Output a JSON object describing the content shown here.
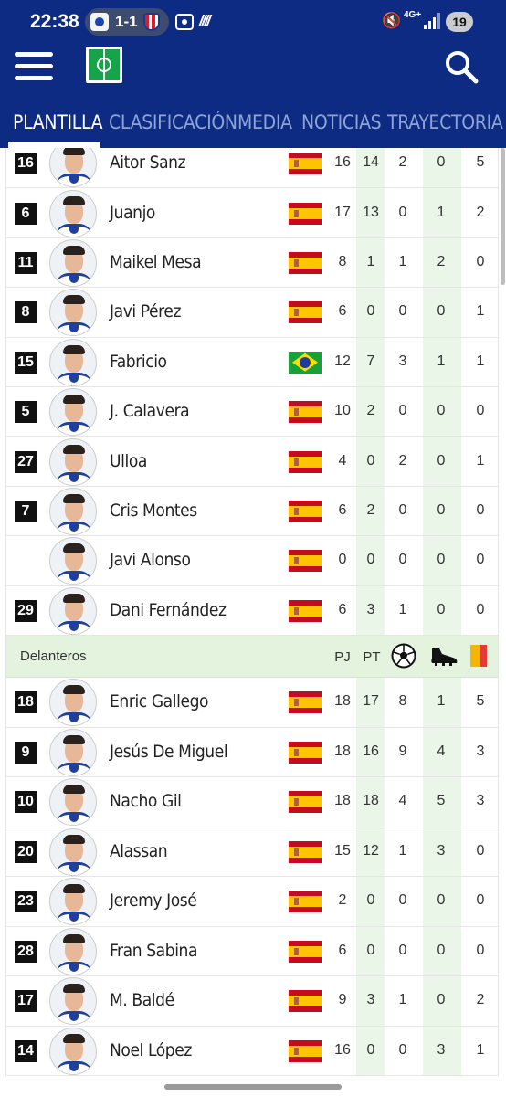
{
  "status_bar": {
    "time": "22:38",
    "score": "1-1",
    "network": "4G+",
    "battery": "19",
    "icons": [
      "real-sociedad-crest-icon",
      "atletico-madrid-crest-icon",
      "screen-cast-icon",
      "nfc-icon",
      "mute-icon",
      "signal-icon",
      "battery-icon"
    ]
  },
  "app_bar": {
    "icons": [
      "hamburger-menu-icon",
      "pitch-icon",
      "search-icon"
    ]
  },
  "tabs": [
    {
      "label": "PLANTILLA",
      "active": true
    },
    {
      "label": "CLASIFICACIÓN",
      "active": false
    },
    {
      "label": "MEDIA",
      "active": false
    },
    {
      "label": "NOTICIAS",
      "active": false
    },
    {
      "label": "TRAYECTORIA",
      "active": false
    }
  ],
  "midfielders": [
    {
      "number": "16",
      "name": "Aitor Sanz",
      "flag": "spain",
      "pj": "16",
      "pt": "14",
      "goals": "2",
      "assists": "0",
      "cards": "5"
    },
    {
      "number": "6",
      "name": "Juanjo",
      "flag": "spain",
      "pj": "17",
      "pt": "13",
      "goals": "0",
      "assists": "1",
      "cards": "2"
    },
    {
      "number": "11",
      "name": "Maikel Mesa",
      "flag": "spain",
      "pj": "8",
      "pt": "1",
      "goals": "1",
      "assists": "2",
      "cards": "0"
    },
    {
      "number": "8",
      "name": "Javi Pérez",
      "flag": "spain",
      "pj": "6",
      "pt": "0",
      "goals": "0",
      "assists": "0",
      "cards": "1"
    },
    {
      "number": "15",
      "name": "Fabricio",
      "flag": "brazil",
      "pj": "12",
      "pt": "7",
      "goals": "3",
      "assists": "1",
      "cards": "1"
    },
    {
      "number": "5",
      "name": "J. Calavera",
      "flag": "spain",
      "pj": "10",
      "pt": "2",
      "goals": "0",
      "assists": "0",
      "cards": "0"
    },
    {
      "number": "27",
      "name": "Ulloa",
      "flag": "spain",
      "pj": "4",
      "pt": "0",
      "goals": "2",
      "assists": "0",
      "cards": "1"
    },
    {
      "number": "7",
      "name": "Cris Montes",
      "flag": "spain",
      "pj": "6",
      "pt": "2",
      "goals": "0",
      "assists": "0",
      "cards": "0"
    },
    {
      "number": "",
      "name": "Javi Alonso",
      "flag": "spain",
      "pj": "0",
      "pt": "0",
      "goals": "0",
      "assists": "0",
      "cards": "0"
    },
    {
      "number": "29",
      "name": "Dani Fernández",
      "flag": "spain",
      "pj": "6",
      "pt": "3",
      "goals": "1",
      "assists": "0",
      "cards": "0"
    }
  ],
  "forwards_section": {
    "title": "Delanteros",
    "col_pj": "PJ",
    "col_pt": "PT",
    "icons": [
      "football-icon",
      "boot-icon",
      "yellow-card-icon"
    ]
  },
  "forwards": [
    {
      "number": "18",
      "name": "Enric Gallego",
      "flag": "spain",
      "pj": "18",
      "pt": "17",
      "goals": "8",
      "assists": "1",
      "cards": "5"
    },
    {
      "number": "9",
      "name": "Jesús De Miguel",
      "flag": "spain",
      "pj": "18",
      "pt": "16",
      "goals": "9",
      "assists": "4",
      "cards": "3"
    },
    {
      "number": "10",
      "name": "Nacho Gil",
      "flag": "spain",
      "pj": "18",
      "pt": "18",
      "goals": "4",
      "assists": "5",
      "cards": "3"
    },
    {
      "number": "20",
      "name": "Alassan",
      "flag": "spain",
      "pj": "15",
      "pt": "12",
      "goals": "1",
      "assists": "3",
      "cards": "0"
    },
    {
      "number": "23",
      "name": "Jeremy José",
      "flag": "spain",
      "pj": "2",
      "pt": "0",
      "goals": "0",
      "assists": "0",
      "cards": "0"
    },
    {
      "number": "28",
      "name": "Fran Sabina",
      "flag": "spain",
      "pj": "6",
      "pt": "0",
      "goals": "0",
      "assists": "0",
      "cards": "0"
    },
    {
      "number": "17",
      "name": "M. Baldé",
      "flag": "spain",
      "pj": "9",
      "pt": "3",
      "goals": "1",
      "assists": "0",
      "cards": "2"
    },
    {
      "number": "14",
      "name": "Noel López",
      "flag": "spain",
      "pj": "16",
      "pt": "0",
      "goals": "0",
      "assists": "3",
      "cards": "1"
    }
  ],
  "colors": {
    "header_bg": "#0d2b82",
    "tab_inactive": "#8ea4d8",
    "section_bg": "#e3f3dd",
    "highlight_col": "#eaf6e8"
  }
}
